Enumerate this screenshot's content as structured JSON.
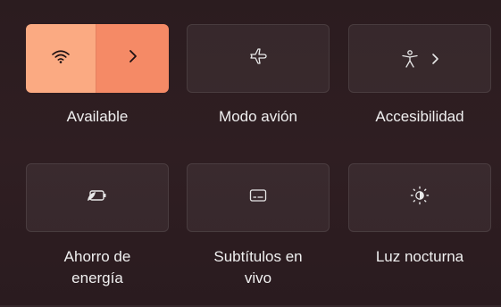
{
  "tiles": [
    {
      "label": "Available"
    },
    {
      "label": "Modo avión"
    },
    {
      "label": "Accesibilidad"
    },
    {
      "label": "Ahorro de energía",
      "line1": "Ahorro de",
      "line2": "energía"
    },
    {
      "label": "Subtítulos en vivo",
      "line1": "Subtítulos en",
      "line2": "vivo"
    },
    {
      "label": "Luz nocturna"
    }
  ],
  "icons": {
    "wifi": "wifi-icon",
    "chevron": "chevron-right-icon",
    "airplane": "airplane-icon",
    "accessibility": "accessibility-icon",
    "battery_saver": "battery-saver-icon",
    "captions": "live-captions-icon",
    "night_light": "night-light-icon"
  },
  "colors": {
    "wifi_active": "#fbaa82",
    "wifi_chevron_active": "#f58a66",
    "background": "#2b1c1f"
  }
}
